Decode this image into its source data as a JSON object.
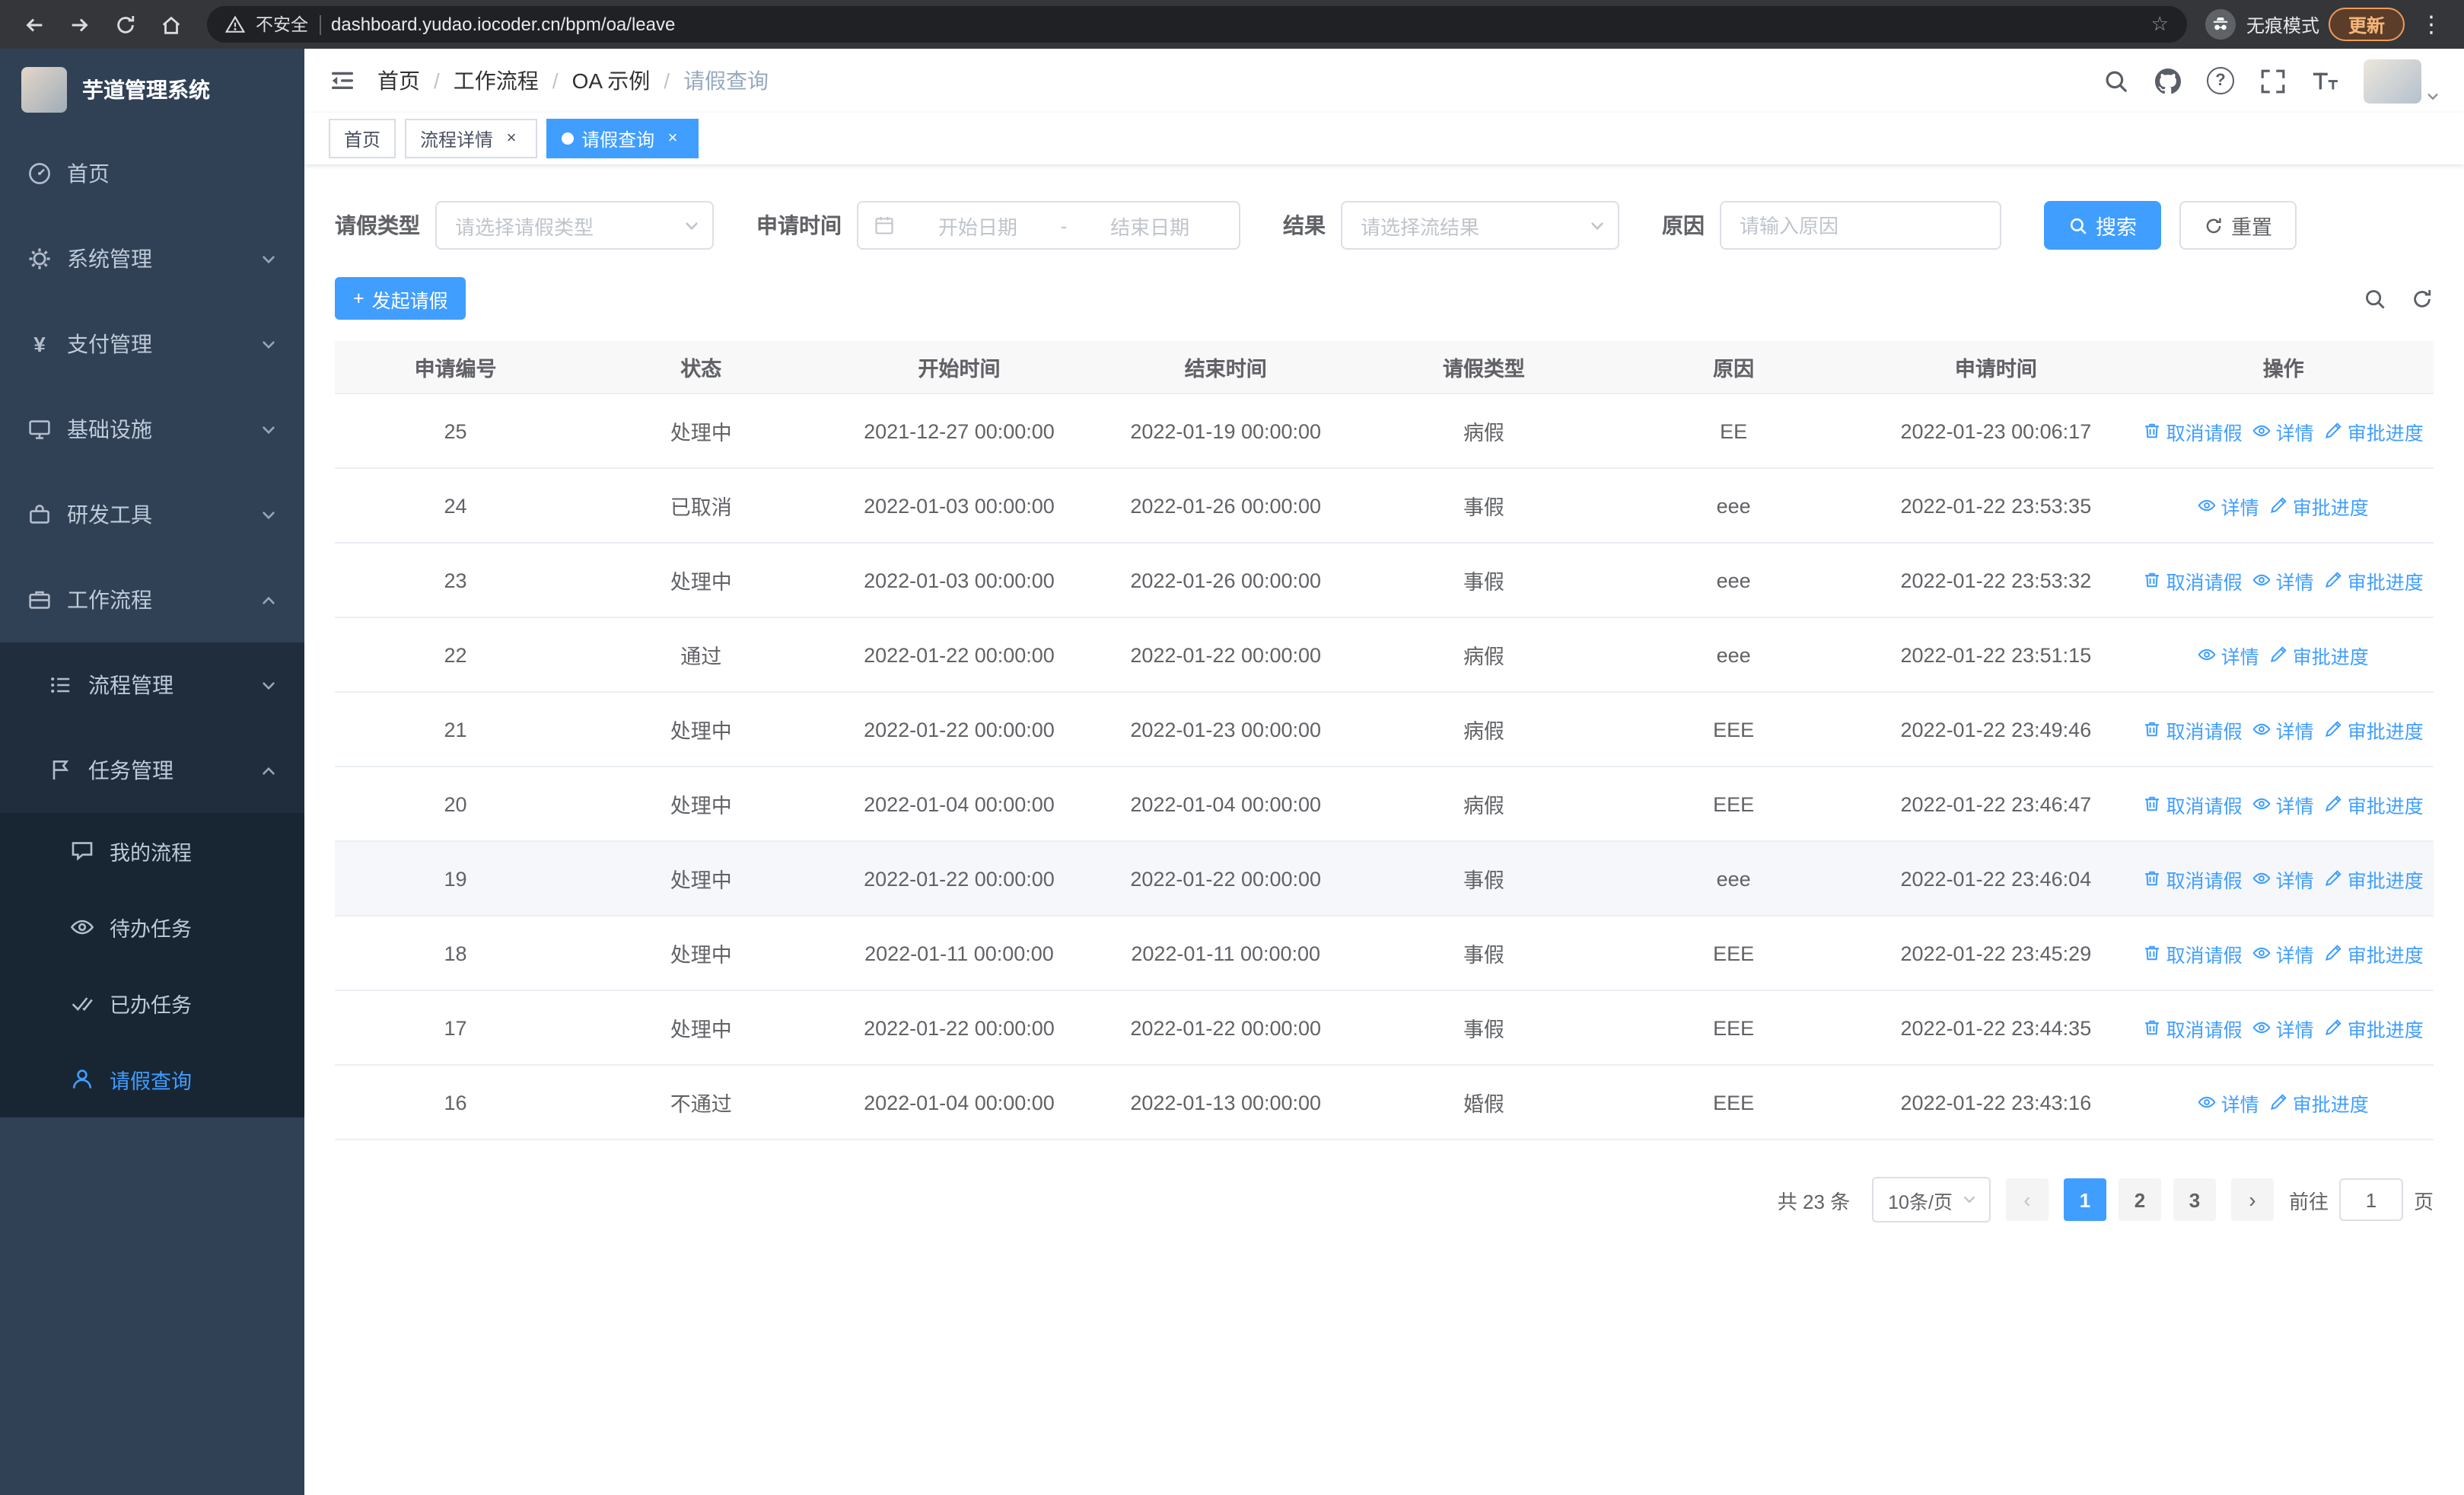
{
  "colors": {
    "primary": "#409eff",
    "sidebar_bg": "#304156",
    "submenu_bg": "#1f2d3d"
  },
  "icons": {
    "close": "×",
    "star": "☆",
    "more_vertical": "⋮",
    "plus": "+",
    "yen": "¥",
    "question": "?",
    "prev": "‹",
    "next": "›"
  },
  "browser": {
    "security_label": "不安全",
    "url": "dashboard.yudao.iocoder.cn/bpm/oa/leave",
    "incognito_label": "无痕模式",
    "update_button": "更新"
  },
  "sidebar": {
    "title": "芋道管理系统",
    "items": [
      {
        "label": "首页"
      },
      {
        "label": "系统管理"
      },
      {
        "label": "支付管理"
      },
      {
        "label": "基础设施"
      },
      {
        "label": "研发工具"
      },
      {
        "label": "工作流程"
      }
    ],
    "submenu": [
      {
        "label": "流程管理"
      },
      {
        "label": "任务管理"
      }
    ],
    "task_items": [
      {
        "label": "我的流程"
      },
      {
        "label": "待办任务"
      },
      {
        "label": "已办任务"
      },
      {
        "label": "请假查询"
      }
    ]
  },
  "header": {
    "breadcrumb": [
      "首页",
      "工作流程",
      "OA 示例",
      "请假查询"
    ],
    "breadcrumb_separator": "/"
  },
  "tabs": [
    {
      "label": "首页"
    },
    {
      "label": "流程详情"
    },
    {
      "label": "请假查询"
    }
  ],
  "filters": {
    "leave_type_label": "请假类型",
    "leave_type_placeholder": "请选择请假类型",
    "apply_time_label": "申请时间",
    "start_date_placeholder": "开始日期",
    "range_separator": "-",
    "end_date_placeholder": "结束日期",
    "result_label": "结果",
    "result_placeholder": "请选择流结果",
    "reason_label": "原因",
    "reason_placeholder": "请输入原因",
    "search_button": "搜索",
    "reset_button": "重置"
  },
  "toolbar": {
    "create_button": "发起请假"
  },
  "table": {
    "columns": [
      "申请编号",
      "状态",
      "开始时间",
      "结束时间",
      "请假类型",
      "原因",
      "申请时间",
      "操作"
    ],
    "action_labels": {
      "cancel": "取消请假",
      "detail": "详情",
      "progress": "审批进度"
    },
    "rows": [
      {
        "id": "25",
        "status": "处理中",
        "start_time": "2021-12-27 00:00:00",
        "end_time": "2022-01-19 00:00:00",
        "leave_type": "病假",
        "reason": "EE",
        "apply_time": "2022-01-23 00:06:17",
        "actions": [
          "cancel",
          "detail",
          "progress"
        ]
      },
      {
        "id": "24",
        "status": "已取消",
        "start_time": "2022-01-03 00:00:00",
        "end_time": "2022-01-26 00:00:00",
        "leave_type": "事假",
        "reason": "eee",
        "apply_time": "2022-01-22 23:53:35",
        "actions": [
          "detail",
          "progress"
        ]
      },
      {
        "id": "23",
        "status": "处理中",
        "start_time": "2022-01-03 00:00:00",
        "end_time": "2022-01-26 00:00:00",
        "leave_type": "事假",
        "reason": "eee",
        "apply_time": "2022-01-22 23:53:32",
        "actions": [
          "cancel",
          "detail",
          "progress"
        ]
      },
      {
        "id": "22",
        "status": "通过",
        "start_time": "2022-01-22 00:00:00",
        "end_time": "2022-01-22 00:00:00",
        "leave_type": "病假",
        "reason": "eee",
        "apply_time": "2022-01-22 23:51:15",
        "actions": [
          "detail",
          "progress"
        ]
      },
      {
        "id": "21",
        "status": "处理中",
        "start_time": "2022-01-22 00:00:00",
        "end_time": "2022-01-23 00:00:00",
        "leave_type": "病假",
        "reason": "EEE",
        "apply_time": "2022-01-22 23:49:46",
        "actions": [
          "cancel",
          "detail",
          "progress"
        ]
      },
      {
        "id": "20",
        "status": "处理中",
        "start_time": "2022-01-04 00:00:00",
        "end_time": "2022-01-04 00:00:00",
        "leave_type": "病假",
        "reason": "EEE",
        "apply_time": "2022-01-22 23:46:47",
        "actions": [
          "cancel",
          "detail",
          "progress"
        ]
      },
      {
        "id": "19",
        "status": "处理中",
        "start_time": "2022-01-22 00:00:00",
        "end_time": "2022-01-22 00:00:00",
        "leave_type": "事假",
        "reason": "eee",
        "apply_time": "2022-01-22 23:46:04",
        "actions": [
          "cancel",
          "detail",
          "progress"
        ],
        "highlight": true
      },
      {
        "id": "18",
        "status": "处理中",
        "start_time": "2022-01-11 00:00:00",
        "end_time": "2022-01-11 00:00:00",
        "leave_type": "事假",
        "reason": "EEE",
        "apply_time": "2022-01-22 23:45:29",
        "actions": [
          "cancel",
          "detail",
          "progress"
        ]
      },
      {
        "id": "17",
        "status": "处理中",
        "start_time": "2022-01-22 00:00:00",
        "end_time": "2022-01-22 00:00:00",
        "leave_type": "事假",
        "reason": "EEE",
        "apply_time": "2022-01-22 23:44:35",
        "actions": [
          "cancel",
          "detail",
          "progress"
        ]
      },
      {
        "id": "16",
        "status": "不通过",
        "start_time": "2022-01-04 00:00:00",
        "end_time": "2022-01-13 00:00:00",
        "leave_type": "婚假",
        "reason": "EEE",
        "apply_time": "2022-01-22 23:43:16",
        "actions": [
          "detail",
          "progress"
        ]
      }
    ]
  },
  "pagination": {
    "total": "共 23 条",
    "page_size": "10条/页",
    "pages": [
      "1",
      "2",
      "3"
    ],
    "active_page": "1",
    "goto_label": "前往",
    "goto_value": "1",
    "goto_unit": "页"
  }
}
